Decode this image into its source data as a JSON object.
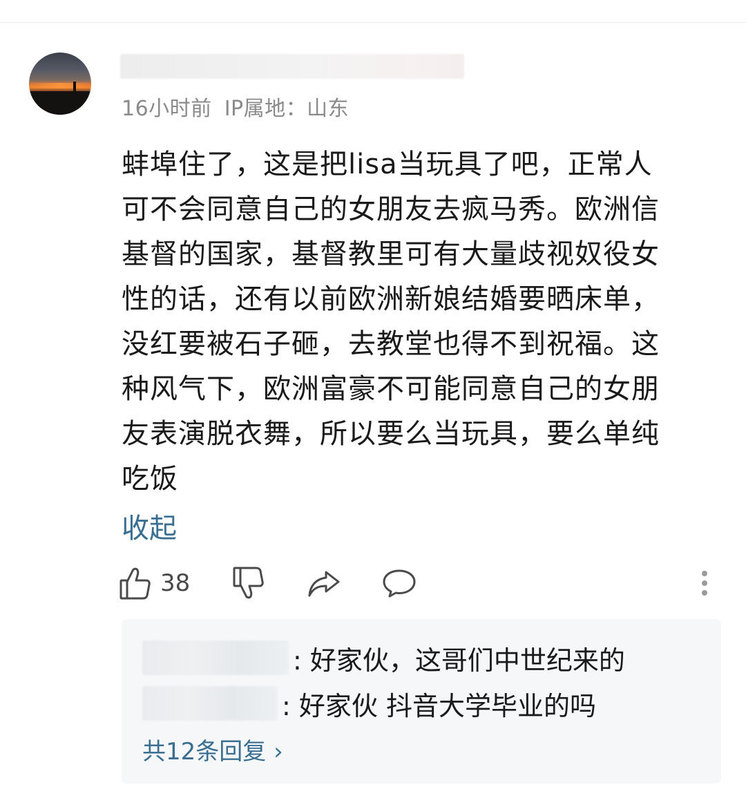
{
  "comment": {
    "meta": {
      "time": "16小时前",
      "ip_location": "IP属地：山东"
    },
    "body_lines": [
      "蚌埠住了，这是把lisa当玩具了吧，正常人",
      "可不会同意自己的女朋友去疯马秀。欧洲信",
      "基督的国家，基督教里可有大量歧视奴役女",
      "性的话，还有以前欧洲新娘结婚要晒床单，",
      "没红要被石子砸，去教堂也得不到祝福。这",
      "种风气下，欧洲富豪不可能同意自己的女朋",
      "友表演脱衣舞，所以要么当玩具，要么单纯",
      "吃饭"
    ],
    "collapse_label": "收起"
  },
  "actions": {
    "like_count": "38",
    "icons": [
      "thumbs-up-icon",
      "thumbs-down-icon",
      "share-icon",
      "comment-icon",
      "more-vertical-icon"
    ]
  },
  "replies": {
    "items": [
      {
        "text": ": 好家伙，这哥们中世纪来的"
      },
      {
        "text": ": 好家伙 抖音大学毕业的吗"
      }
    ],
    "more_label": "共12条回复 ›"
  },
  "colors": {
    "link": "#3a6f92",
    "meta": "#8a8a8a",
    "reply_bg": "#f6f7f8"
  }
}
